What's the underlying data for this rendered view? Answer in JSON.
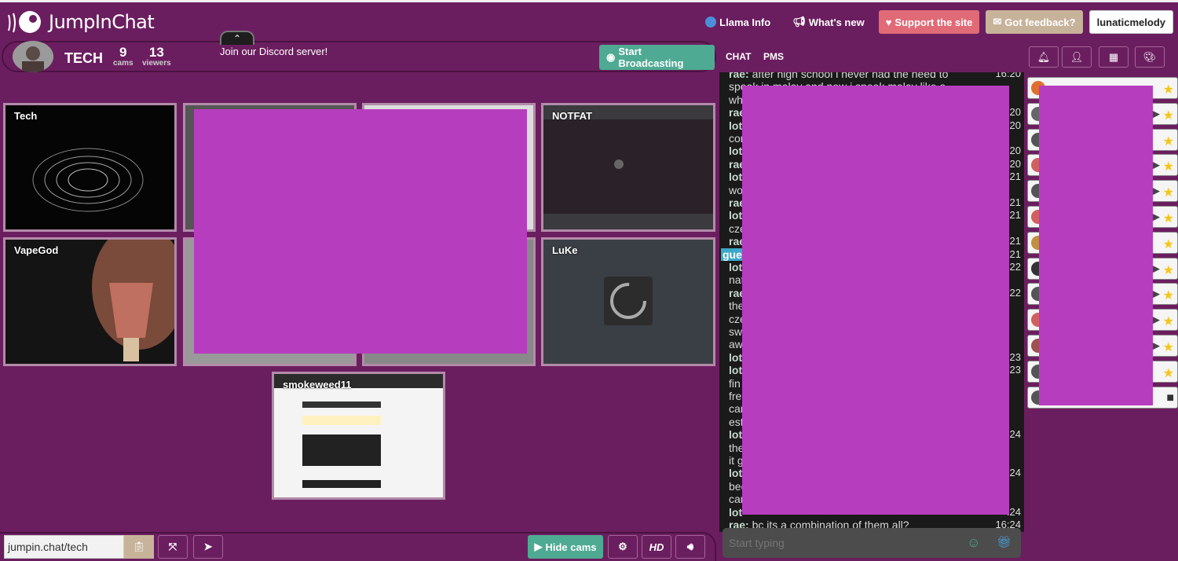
{
  "app": {
    "name": "JumpInChat"
  },
  "nav": {
    "llama_info": "Llama Info",
    "whats_new": "What's new",
    "support": "Support the site",
    "feedback": "Got feedback?",
    "username": "lunaticmelody"
  },
  "room": {
    "name": "TECH",
    "cams_count": "9",
    "cams_label": "cams",
    "viewers_count": "13",
    "viewers_label": "viewers",
    "discord_text": "Join our Discord server!",
    "broadcast_label": "Start Broadcasting"
  },
  "tabs": {
    "chat": "CHAT",
    "pms": "PMS"
  },
  "cams": [
    {
      "label": "Tech"
    },
    {
      "label": "NOTFAT"
    },
    {
      "label": "VapeGod"
    },
    {
      "label": "LuKe"
    },
    {
      "label": "smokeweed11"
    }
  ],
  "chat": {
    "lines": [
      {
        "nick": "rae:",
        "text": " after high school i never had the need to",
        "time": "16:20"
      },
      {
        "nick": "",
        "text": "speak in malay and now i speak malay like a",
        "time": ""
      },
      {
        "nick": "",
        "text": "wh",
        "time": ""
      },
      {
        "nick": "rae",
        "text": "",
        "time": ":20"
      },
      {
        "nick": "lot",
        "text": "",
        "time": ":20"
      },
      {
        "nick": "",
        "text": "cor",
        "time": ""
      },
      {
        "nick": "lot",
        "text": "",
        "time": ":20"
      },
      {
        "nick": "rae",
        "text": "",
        "time": ":20"
      },
      {
        "nick": "lot",
        "text": "",
        "time": ":21"
      },
      {
        "nick": "",
        "text": "wo",
        "time": ""
      },
      {
        "nick": "rae",
        "text": "",
        "time": ":21"
      },
      {
        "nick": "lot",
        "text": "",
        "time": ":21"
      },
      {
        "nick": "",
        "text": "cze",
        "time": ""
      },
      {
        "nick": "rae",
        "text": "",
        "time": ":21"
      },
      {
        "nick": "gues",
        "text": "",
        "time": ":21"
      },
      {
        "nick": "lot",
        "text": "",
        "time": ":22"
      },
      {
        "nick": "",
        "text": "nat",
        "time": ""
      },
      {
        "nick": "rae",
        "text": "",
        "time": ":22"
      },
      {
        "nick": "",
        "text": "the",
        "time": ""
      },
      {
        "nick": "",
        "text": "cze",
        "time": ""
      },
      {
        "nick": "",
        "text": "sw",
        "time": ""
      },
      {
        "nick": "",
        "text": "aw",
        "time": ""
      },
      {
        "nick": "lot",
        "text": "",
        "time": ":23"
      },
      {
        "nick": "lot",
        "text": "",
        "time": ":23"
      },
      {
        "nick": "",
        "text": "fin",
        "time": ""
      },
      {
        "nick": "",
        "text": "fre",
        "time": ""
      },
      {
        "nick": "",
        "text": "car",
        "time": ""
      },
      {
        "nick": "",
        "text": "est",
        "time": ""
      },
      {
        "nick": "lot",
        "text": "",
        "time": ":24"
      },
      {
        "nick": "",
        "text": "the",
        "time": ""
      },
      {
        "nick": "",
        "text": "it g",
        "time": ""
      },
      {
        "nick": "lot",
        "text": "",
        "time": ":24"
      },
      {
        "nick": "",
        "text": "bec",
        "time": ""
      },
      {
        "nick": "",
        "text": "car",
        "time": ""
      },
      {
        "nick": "lot",
        "text": "",
        "time": ":24"
      },
      {
        "nick": "rae:",
        "text": " bc its a combination of them all?",
        "time": "16:24"
      }
    ],
    "input_placeholder": "Start typing"
  },
  "bottom": {
    "url": "jumpin.chat/tech",
    "hide_cams": "Hide cams",
    "hd": "HD"
  },
  "colors": {
    "background": "#6b1e5f",
    "accent_green": "#4faa93",
    "support_red": "#e06b77",
    "feedback_tan": "#c7b39a",
    "redaction": "#b73dbf"
  }
}
